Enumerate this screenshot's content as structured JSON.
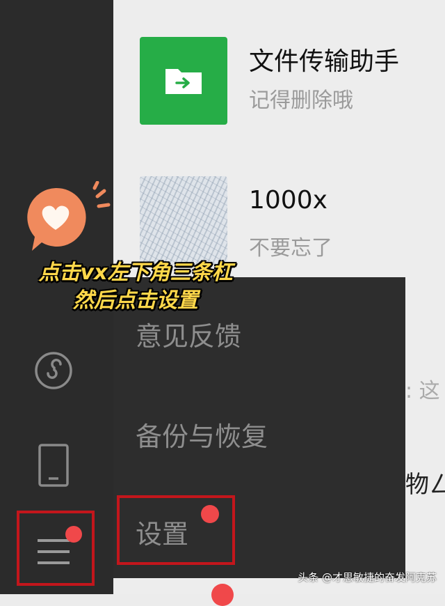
{
  "chats": [
    {
      "name": "文件传输助手",
      "preview": "记得删除哦",
      "avatar_icon": "folder-arrow-icon"
    },
    {
      "name": "1000x",
      "preview": "不要忘了",
      "avatar_icon": "sketch-avatar"
    }
  ],
  "partial_texts": [
    ": 这",
    "物ㄥ"
  ],
  "menu": {
    "items": [
      "意见反馈",
      "备份与恢复",
      "设置"
    ]
  },
  "caption": {
    "line1": "点击vx左下角三条杠",
    "line2": "然后点击设置"
  },
  "watermark": "头条 @才思敏捷的奋发阿克苏",
  "colors": {
    "sidebar": "#2b2b2b",
    "menu": "#2d2d2d",
    "accent_green": "#26ad47",
    "badge_red": "#f0484a",
    "highlight_red": "#c3161c",
    "caption_yellow": "#ffd84a",
    "sticker_orange": "#f08a5d"
  }
}
